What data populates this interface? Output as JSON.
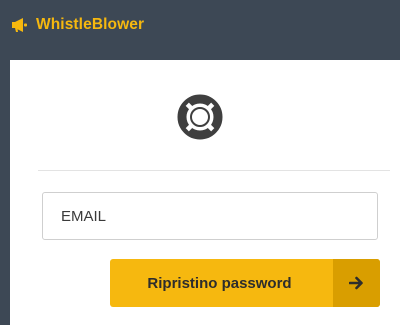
{
  "app": {
    "name": "WhistleBlower",
    "logo_icon": "megaphone-icon",
    "accent_color": "#f6b80f"
  },
  "reset": {
    "icon": "lifebuoy-icon",
    "email_placeholder": "EMAIL",
    "email_value": "",
    "submit_label": "Ripristino password",
    "submit_icon": "arrow-right-icon"
  }
}
